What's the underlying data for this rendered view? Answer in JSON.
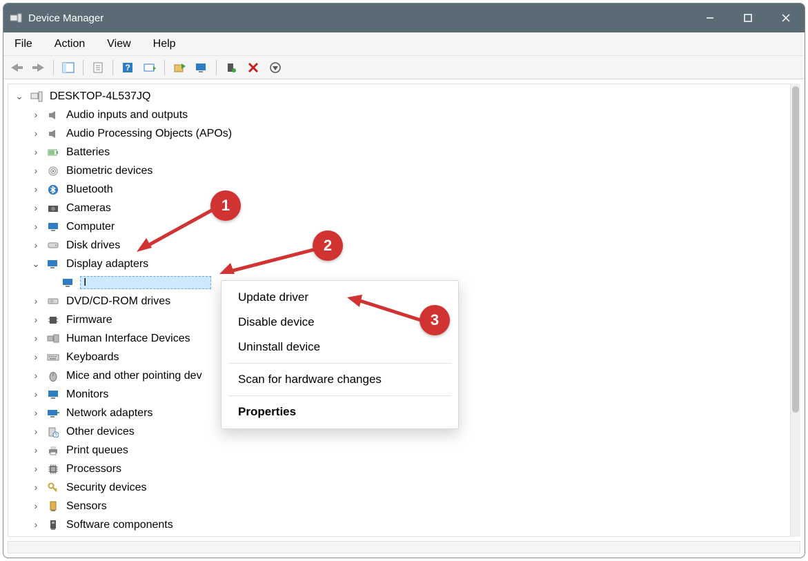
{
  "window": {
    "title": "Device Manager"
  },
  "menu": {
    "file": "File",
    "action": "Action",
    "view": "View",
    "help": "Help"
  },
  "tree": {
    "root": "DESKTOP-4L537JQ",
    "nodes": {
      "audio_io": "Audio inputs and outputs",
      "audio_apo": "Audio Processing Objects (APOs)",
      "batteries": "Batteries",
      "biometric": "Biometric devices",
      "bluetooth": "Bluetooth",
      "cameras": "Cameras",
      "computer": "Computer",
      "disk": "Disk drives",
      "display": "Display adapters",
      "display_child": "I",
      "dvd": "DVD/CD-ROM drives",
      "firmware": "Firmware",
      "hid": "Human Interface Devices",
      "keyboards": "Keyboards",
      "mice": "Mice and other pointing dev",
      "monitors": "Monitors",
      "network": "Network adapters",
      "other": "Other devices",
      "print": "Print queues",
      "processors": "Processors",
      "security": "Security devices",
      "sensors": "Sensors",
      "software": "Software components"
    }
  },
  "context_menu": {
    "update": "Update driver",
    "disable": "Disable device",
    "uninstall": "Uninstall device",
    "scan": "Scan for hardware changes",
    "properties": "Properties"
  },
  "annotations": {
    "b1": "1",
    "b2": "2",
    "b3": "3"
  }
}
